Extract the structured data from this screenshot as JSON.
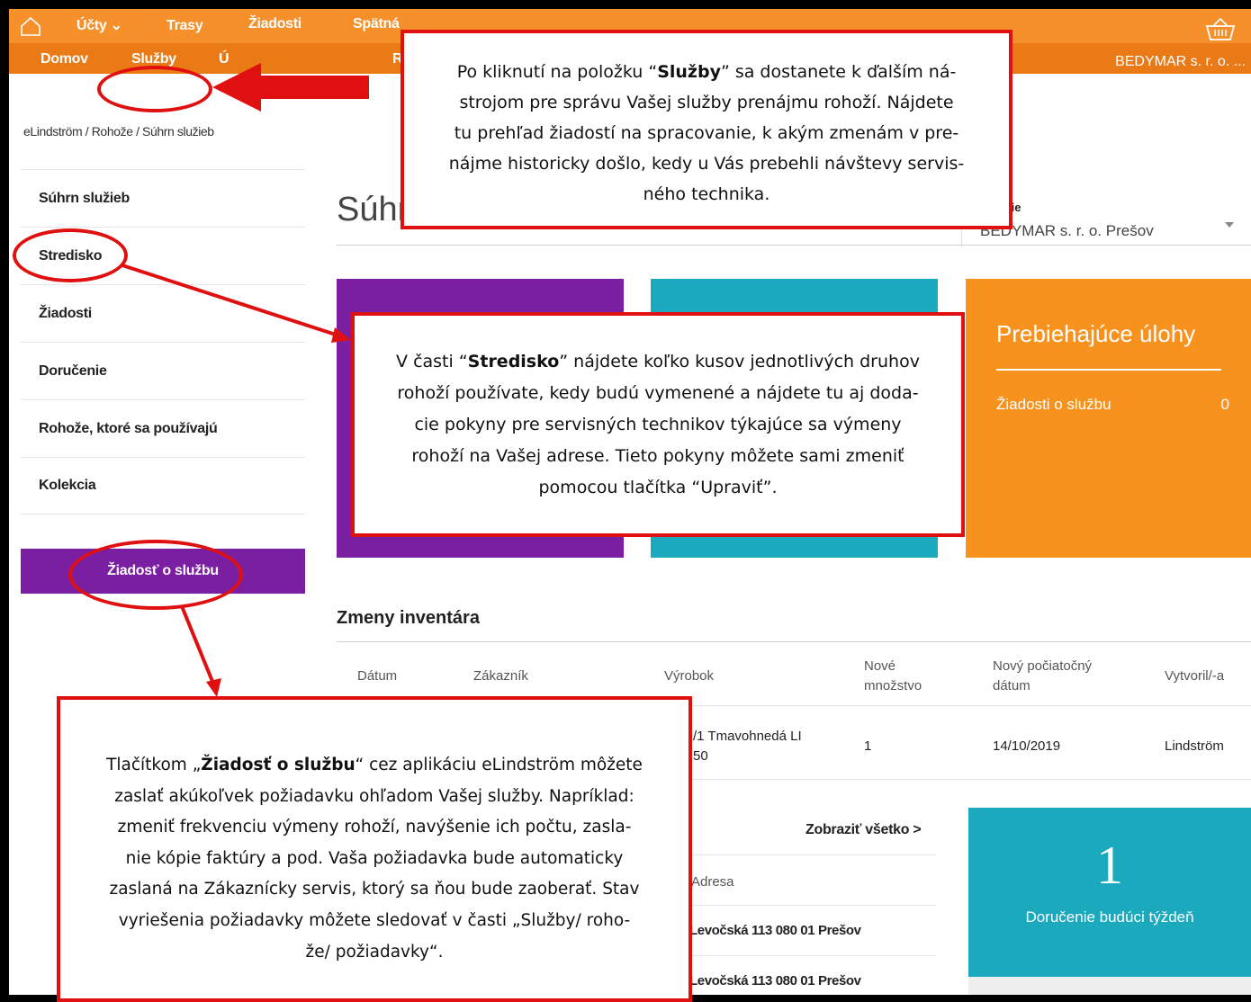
{
  "nav": {
    "top": [
      "Účty",
      "Trasy",
      "Žiadosti",
      "Spätná"
    ],
    "second": [
      "Domov",
      "Služby",
      "Ú",
      "R"
    ],
    "company": "BEDYMAR s. r. o. ..."
  },
  "breadcrumb": "eLindström / Rohože / Súhrn služieb",
  "sidebar": {
    "items": [
      "Súhrn služieb",
      "Stredisko",
      "Žiadosti",
      "Doručenie",
      "Rohože, ktoré sa používajú",
      "Kolekcia"
    ],
    "button": "Žiadosť o službu"
  },
  "page": {
    "title": "Súhrn",
    "location_label": "stnenie",
    "location_value": "BEDYMAR s. r. o. Prešov"
  },
  "tiles": {
    "orange_title": "Prebiehajúce úlohy",
    "orange_row_label": "Žiadosti o službu",
    "orange_row_value": "0"
  },
  "inventory": {
    "title": "Zmeny inventára",
    "headers": [
      "Dátum",
      "Zákazník",
      "Výrobok",
      "Nové množstvo",
      "Nový počiatočný dátum",
      "Vytvoril/-a"
    ],
    "row": {
      "product": "/1 Tmavohnedá LI 50",
      "qty": "1",
      "date": "14/10/2019",
      "by": "Lindström"
    }
  },
  "deliveries": {
    "show_all": "Zobraziť všetko >",
    "addr_header": "Adresa",
    "rows": [
      "Levočská 113 080 01 Prešov",
      "Levočská 113 080 01 Prešov"
    ],
    "count": "1",
    "count_label": "Doručenie budúci týždeň"
  },
  "callouts": {
    "c1": [
      "Po kliknutí na položku “",
      "Služby",
      "” sa dostanete k ďalším ná-",
      "strojom pre správu Vašej služby prenájmu rohoží. Nájdete",
      "tu prehľad žiadostí na spracovanie, k akým zmenám v pre-",
      "nájme historicky došlo, kedy u Vás prebehli návštevy servis-",
      "ného technika."
    ],
    "c2": [
      "V časti “",
      "Stredisko",
      "” nájdete koľko kusov jednotlivých druhov",
      "rohoží používate, kedy budú vymenené a nájdete tu aj doda-",
      "cie pokyny pre servisných technikov týkajúce sa výmeny",
      "rohoží na Vašej adrese. Tieto pokyny môžete sami zmeniť",
      "pomocou tlačítka “Upraviť”."
    ],
    "c3": [
      "Tlačítkom „",
      "Žiadosť o službu",
      "“ cez aplikáciu eLindström môžete",
      "zaslať akúkoľvek požiadavku ohľadom Vašej služby. Napríklad:",
      "zmeniť frekvenciu výmeny rohoží, navýšenie ich počtu, zasla-",
      "nie kópie faktúry a pod. Vaša požiadavka bude automaticky",
      "zaslaná na Zákaznícky servis, ktorý sa  ňou bude zaoberať. Stav",
      "vyriešenia požiadavky môžete sledovať v časti „Služby/ roho-",
      "že/ požiadavky“."
    ]
  },
  "colors": {
    "orange": "#f0821e",
    "purple": "#7b1fa2",
    "teal": "#1aa9bd",
    "red": "#e01010"
  }
}
